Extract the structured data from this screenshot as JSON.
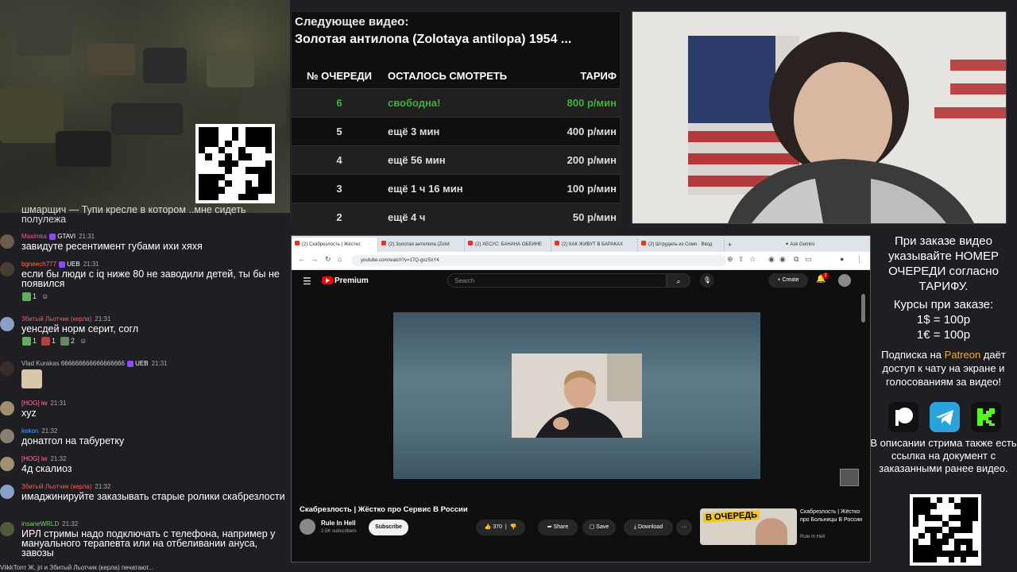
{
  "queue": {
    "next_label": "Следующее видео:",
    "next_title": "Золотая антилопа (Zolotaya antilopa) 1954 ...",
    "headers": [
      "№ ОЧЕРЕДИ",
      "ОСТАЛОСЬ СМОТРЕТЬ",
      "ТАРИФ"
    ],
    "rows": [
      {
        "num": "6",
        "remaining": "свободна!",
        "rate": "800 р/мин"
      },
      {
        "num": "5",
        "remaining": "ещё 3 мин",
        "rate": "400 р/мин"
      },
      {
        "num": "4",
        "remaining": "ещё 56 мин",
        "rate": "200 р/мин"
      },
      {
        "num": "3",
        "remaining": "ещё 1 ч 16 мин",
        "rate": "100 р/мин"
      },
      {
        "num": "2",
        "remaining": "ещё 4 ч",
        "rate": "50 р/мин"
      }
    ],
    "free_color": "#3fb13c"
  },
  "chat": {
    "partial_top": "шмарщич — Тупи кресле в котором ..мне сидеть полулежа",
    "messages": [
      {
        "user": "Maximka",
        "badge": "GTAVI",
        "time": "21:31",
        "color": "#ff4f8b",
        "text": "завидуте ресентимент губами ихи хяхя"
      },
      {
        "user": "bgneech777",
        "badge": "UEB",
        "time": "21:31",
        "color": "#ff6b47",
        "text": "если бы люди с iq ниже 80 не заводили детей, ты бы не появился",
        "reactions": [
          "1"
        ]
      },
      {
        "user": "Збитый Льотчик (керла)",
        "time": "21:31",
        "color": "#ff5a5a",
        "text": "уенсдей норм серит, согл",
        "reactions": [
          "1",
          "1",
          "2"
        ]
      },
      {
        "user": "Vlad Kurakas",
        "badge": "UEB",
        "time": "21:31",
        "color": "#bbbbbb",
        "text": "666666666666666666"
      },
      {
        "user": "[HOG] iw",
        "time": "21:31",
        "color": "#ff7a9c",
        "text": "xyz"
      },
      {
        "user": "kekon",
        "time": "21:32",
        "color": "#4aa3ff",
        "text": "донатгол на табуретку"
      },
      {
        "user": "[HOG] iw",
        "time": "21:32",
        "color": "#ff7a9c",
        "text": "4д скалиоз"
      },
      {
        "user": "Збитый Льотчик (керла)",
        "time": "21:32",
        "color": "#ff5a5a",
        "text": "имаджинируйте заказывать старые ролики скабрезлости"
      },
      {
        "user": "insaneWRLD",
        "time": "21:32",
        "color": "#6fd46f",
        "text": "ИРЛ стримы надо подключать с телефона, например у мануального терапевта или на отбеливании ануса, завозы"
      }
    ],
    "typing": "ViikkTorrr Ж, jri и Збитый Льотчик (керла) печатают..."
  },
  "browser": {
    "tabs": [
      "(2) Скабрезлость | Жёстко",
      "(2) Золотая антилопа (Zolot",
      "(2) ХЕСУС: БАНАНА ОБЕИНЕ",
      "(2) КАК ЖИВУТ В БАРАКАХ",
      "(2) Штрудель из Сомо · Ввод"
    ],
    "new_tab": "+",
    "ask": "Ask Gemini",
    "url": "youtube.com/watch?v=17Q-gvzSxY4"
  },
  "youtube": {
    "logo": "Premium",
    "search_placeholder": "Search",
    "create": "Create",
    "notif_count": "2",
    "video_title": "Скабрезлость | Жёстко про Сервис В России",
    "channel": "Rule In Hell",
    "subs": "2.5K subscribers",
    "subscribe": "Subscribe",
    "likes": "370",
    "share": "Share",
    "save": "Save",
    "download": "Download",
    "more": "···",
    "side_label": "В ОЧЕРЕДЬ",
    "side_title": "Скабрезлость | Жёстко про Больницы В России",
    "side_channel": "Rule In Hell"
  },
  "info": {
    "order_note": "При заказе видео указывайте НОМЕР ОЧЕРЕДИ согласно ТАРИФУ.",
    "rates_title": "Курсы при заказе:",
    "rate_usd": "1$ = 100р",
    "rate_eur": "1€ = 100р",
    "sub_prefix": "Подписка на",
    "patreon": "Patreon",
    "sub_suffix": "даёт доступ к чату на экране и голосованиям за видео!",
    "desc_note": "В описании стрима также есть ссылка на документ с заказанными ранее видео."
  }
}
